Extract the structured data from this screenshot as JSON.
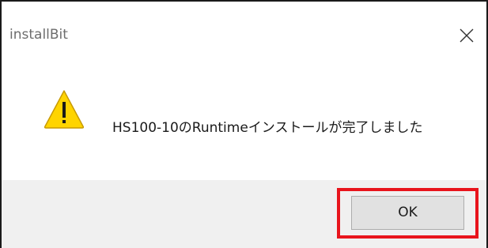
{
  "dialog": {
    "title": "installBit",
    "close_icon": "close-icon",
    "message": "HS100-10のRuntimeインストールが完了しました",
    "icon": "warning-icon",
    "ok_label": "OK"
  },
  "colors": {
    "warning_fill": "#ffd400",
    "warning_stroke": "#c89a00",
    "highlight": "#e8141c",
    "footer_bg": "#f0f0f0",
    "button_bg": "#e1e1e1"
  }
}
